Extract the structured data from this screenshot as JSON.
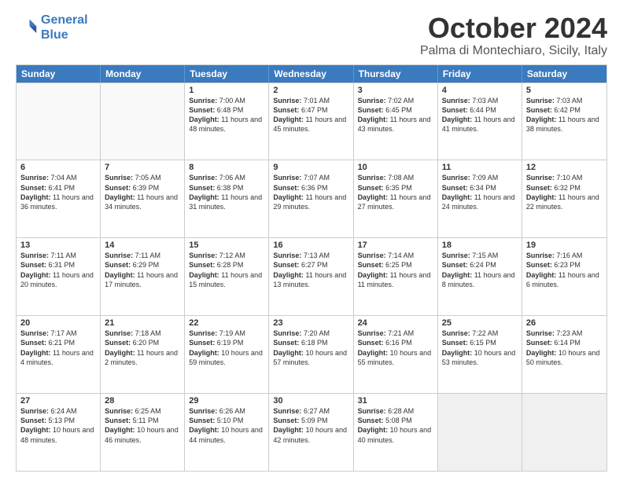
{
  "logo": {
    "line1": "General",
    "line2": "Blue"
  },
  "title": "October 2024",
  "location": "Palma di Montechiaro, Sicily, Italy",
  "header_days": [
    "Sunday",
    "Monday",
    "Tuesday",
    "Wednesday",
    "Thursday",
    "Friday",
    "Saturday"
  ],
  "rows": [
    [
      {
        "day": "",
        "text": "",
        "empty": true
      },
      {
        "day": "",
        "text": "",
        "empty": true
      },
      {
        "day": "1",
        "text": "Sunrise: 7:00 AM\nSunset: 6:48 PM\nDaylight: 11 hours and 48 minutes."
      },
      {
        "day": "2",
        "text": "Sunrise: 7:01 AM\nSunset: 6:47 PM\nDaylight: 11 hours and 45 minutes."
      },
      {
        "day": "3",
        "text": "Sunrise: 7:02 AM\nSunset: 6:45 PM\nDaylight: 11 hours and 43 minutes."
      },
      {
        "day": "4",
        "text": "Sunrise: 7:03 AM\nSunset: 6:44 PM\nDaylight: 11 hours and 41 minutes."
      },
      {
        "day": "5",
        "text": "Sunrise: 7:03 AM\nSunset: 6:42 PM\nDaylight: 11 hours and 38 minutes."
      }
    ],
    [
      {
        "day": "6",
        "text": "Sunrise: 7:04 AM\nSunset: 6:41 PM\nDaylight: 11 hours and 36 minutes."
      },
      {
        "day": "7",
        "text": "Sunrise: 7:05 AM\nSunset: 6:39 PM\nDaylight: 11 hours and 34 minutes."
      },
      {
        "day": "8",
        "text": "Sunrise: 7:06 AM\nSunset: 6:38 PM\nDaylight: 11 hours and 31 minutes."
      },
      {
        "day": "9",
        "text": "Sunrise: 7:07 AM\nSunset: 6:36 PM\nDaylight: 11 hours and 29 minutes."
      },
      {
        "day": "10",
        "text": "Sunrise: 7:08 AM\nSunset: 6:35 PM\nDaylight: 11 hours and 27 minutes."
      },
      {
        "day": "11",
        "text": "Sunrise: 7:09 AM\nSunset: 6:34 PM\nDaylight: 11 hours and 24 minutes."
      },
      {
        "day": "12",
        "text": "Sunrise: 7:10 AM\nSunset: 6:32 PM\nDaylight: 11 hours and 22 minutes."
      }
    ],
    [
      {
        "day": "13",
        "text": "Sunrise: 7:11 AM\nSunset: 6:31 PM\nDaylight: 11 hours and 20 minutes."
      },
      {
        "day": "14",
        "text": "Sunrise: 7:11 AM\nSunset: 6:29 PM\nDaylight: 11 hours and 17 minutes."
      },
      {
        "day": "15",
        "text": "Sunrise: 7:12 AM\nSunset: 6:28 PM\nDaylight: 11 hours and 15 minutes."
      },
      {
        "day": "16",
        "text": "Sunrise: 7:13 AM\nSunset: 6:27 PM\nDaylight: 11 hours and 13 minutes."
      },
      {
        "day": "17",
        "text": "Sunrise: 7:14 AM\nSunset: 6:25 PM\nDaylight: 11 hours and 11 minutes."
      },
      {
        "day": "18",
        "text": "Sunrise: 7:15 AM\nSunset: 6:24 PM\nDaylight: 11 hours and 8 minutes."
      },
      {
        "day": "19",
        "text": "Sunrise: 7:16 AM\nSunset: 6:23 PM\nDaylight: 11 hours and 6 minutes."
      }
    ],
    [
      {
        "day": "20",
        "text": "Sunrise: 7:17 AM\nSunset: 6:21 PM\nDaylight: 11 hours and 4 minutes."
      },
      {
        "day": "21",
        "text": "Sunrise: 7:18 AM\nSunset: 6:20 PM\nDaylight: 11 hours and 2 minutes."
      },
      {
        "day": "22",
        "text": "Sunrise: 7:19 AM\nSunset: 6:19 PM\nDaylight: 10 hours and 59 minutes."
      },
      {
        "day": "23",
        "text": "Sunrise: 7:20 AM\nSunset: 6:18 PM\nDaylight: 10 hours and 57 minutes."
      },
      {
        "day": "24",
        "text": "Sunrise: 7:21 AM\nSunset: 6:16 PM\nDaylight: 10 hours and 55 minutes."
      },
      {
        "day": "25",
        "text": "Sunrise: 7:22 AM\nSunset: 6:15 PM\nDaylight: 10 hours and 53 minutes."
      },
      {
        "day": "26",
        "text": "Sunrise: 7:23 AM\nSunset: 6:14 PM\nDaylight: 10 hours and 50 minutes."
      }
    ],
    [
      {
        "day": "27",
        "text": "Sunrise: 6:24 AM\nSunset: 5:13 PM\nDaylight: 10 hours and 48 minutes."
      },
      {
        "day": "28",
        "text": "Sunrise: 6:25 AM\nSunset: 5:11 PM\nDaylight: 10 hours and 46 minutes."
      },
      {
        "day": "29",
        "text": "Sunrise: 6:26 AM\nSunset: 5:10 PM\nDaylight: 10 hours and 44 minutes."
      },
      {
        "day": "30",
        "text": "Sunrise: 6:27 AM\nSunset: 5:09 PM\nDaylight: 10 hours and 42 minutes."
      },
      {
        "day": "31",
        "text": "Sunrise: 6:28 AM\nSunset: 5:08 PM\nDaylight: 10 hours and 40 minutes."
      },
      {
        "day": "",
        "text": "",
        "empty": true,
        "shaded": true
      },
      {
        "day": "",
        "text": "",
        "empty": true,
        "shaded": true
      }
    ]
  ]
}
